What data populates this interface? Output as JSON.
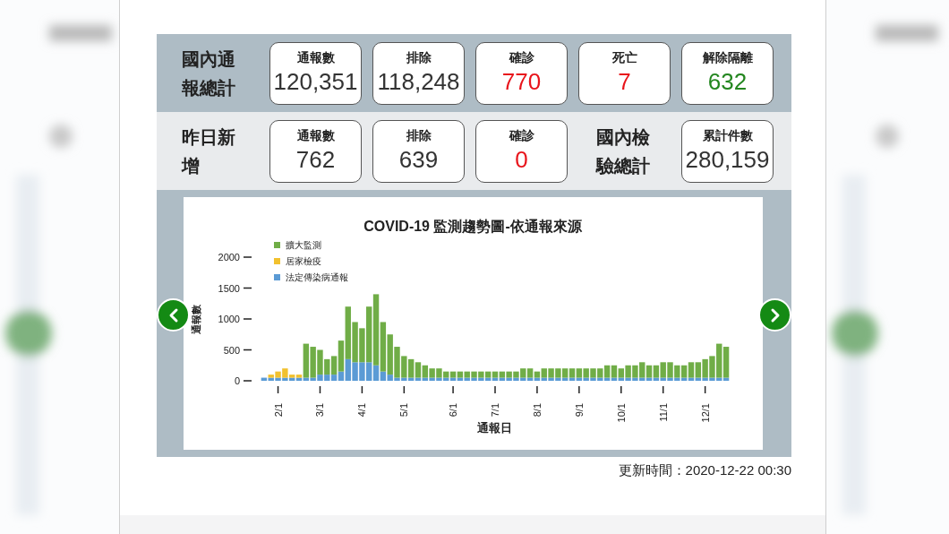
{
  "summary_rows": [
    {
      "label": "國內通報總計",
      "items": [
        {
          "kind": "stat",
          "label": "通報數",
          "value": "120,351",
          "color": "#333333"
        },
        {
          "kind": "stat",
          "label": "排除",
          "value": "118,248",
          "color": "#333333"
        },
        {
          "kind": "stat",
          "label": "確診",
          "value": "770",
          "color": "#e8141b"
        },
        {
          "kind": "stat",
          "label": "死亡",
          "value": "7",
          "color": "#e8141b"
        },
        {
          "kind": "stat",
          "label": "解除隔離",
          "value": "632",
          "color": "#23861f"
        }
      ]
    },
    {
      "label": "昨日新增",
      "items": [
        {
          "kind": "stat",
          "label": "通報數",
          "value": "762",
          "color": "#333333"
        },
        {
          "kind": "stat",
          "label": "排除",
          "value": "639",
          "color": "#333333"
        },
        {
          "kind": "stat",
          "label": "確診",
          "value": "0",
          "color": "#e8141b"
        },
        {
          "kind": "heading",
          "label": "國內檢驗總計"
        },
        {
          "kind": "stat",
          "label": "累計件數",
          "value": "280,159",
          "color": "#333333"
        }
      ]
    }
  ],
  "chart_panel": {
    "chart_data": {
      "type": "bar",
      "stacked": true,
      "title": "COVID-19 監測趨勢圖-依通報來源",
      "xlabel": "通報日",
      "ylabel": "通報數",
      "categories": [
        null,
        null,
        "2/1",
        null,
        null,
        null,
        null,
        null,
        "3/1",
        null,
        null,
        null,
        null,
        null,
        "4/1",
        null,
        null,
        null,
        null,
        null,
        "5/1",
        null,
        null,
        null,
        null,
        null,
        null,
        "6/1",
        null,
        null,
        null,
        null,
        null,
        "7/1",
        null,
        null,
        null,
        null,
        null,
        "8/1",
        null,
        null,
        null,
        null,
        null,
        "9/1",
        null,
        null,
        null,
        null,
        null,
        "10/1",
        null,
        null,
        null,
        null,
        null,
        "11/1",
        null,
        null,
        null,
        null,
        null,
        "12/1",
        null,
        null,
        null
      ],
      "ylim": [
        0,
        2000
      ],
      "legend": "upper left",
      "yticks": [
        0,
        500,
        1000,
        1500,
        2000
      ],
      "series": [
        {
          "name": "法定傳染病通報",
          "color": "#5b9bd5",
          "values": [
            50,
            50,
            50,
            50,
            50,
            50,
            50,
            50,
            100,
            100,
            100,
            150,
            350,
            300,
            300,
            300,
            250,
            150,
            100,
            50,
            50,
            50,
            50,
            50,
            50,
            50,
            50,
            50,
            50,
            50,
            50,
            50,
            50,
            50,
            50,
            50,
            50,
            50,
            50,
            50,
            50,
            50,
            50,
            50,
            50,
            50,
            50,
            50,
            50,
            50,
            50,
            50,
            50,
            50,
            50,
            50,
            50,
            50,
            50,
            50,
            50,
            50,
            50,
            50,
            50,
            50,
            50
          ]
        },
        {
          "name": "居家檢疫",
          "color": "#f2c12e",
          "values": [
            0,
            50,
            100,
            150,
            50,
            50,
            0,
            0,
            0,
            0,
            0,
            0,
            0,
            0,
            0,
            0,
            0,
            0,
            0,
            0,
            0,
            0,
            0,
            0,
            0,
            0,
            0,
            0,
            0,
            0,
            0,
            0,
            0,
            0,
            0,
            0,
            0,
            0,
            0,
            0,
            0,
            0,
            0,
            0,
            0,
            0,
            0,
            0,
            0,
            0,
            0,
            0,
            0,
            0,
            0,
            0,
            0,
            0,
            0,
            0,
            0,
            0,
            0,
            0,
            0,
            0,
            0
          ]
        },
        {
          "name": "擴大監測",
          "color": "#70ad47",
          "values": [
            0,
            0,
            0,
            0,
            0,
            0,
            550,
            500,
            400,
            250,
            300,
            500,
            850,
            650,
            550,
            900,
            1150,
            800,
            650,
            500,
            350,
            300,
            250,
            200,
            150,
            150,
            100,
            100,
            100,
            100,
            100,
            100,
            100,
            100,
            100,
            100,
            100,
            150,
            150,
            100,
            150,
            150,
            150,
            150,
            150,
            150,
            150,
            150,
            150,
            200,
            200,
            150,
            200,
            200,
            250,
            200,
            200,
            250,
            250,
            200,
            200,
            250,
            250,
            300,
            350,
            550,
            500
          ]
        }
      ]
    }
  },
  "updated": "更新時間：2020-12-22 00:30"
}
